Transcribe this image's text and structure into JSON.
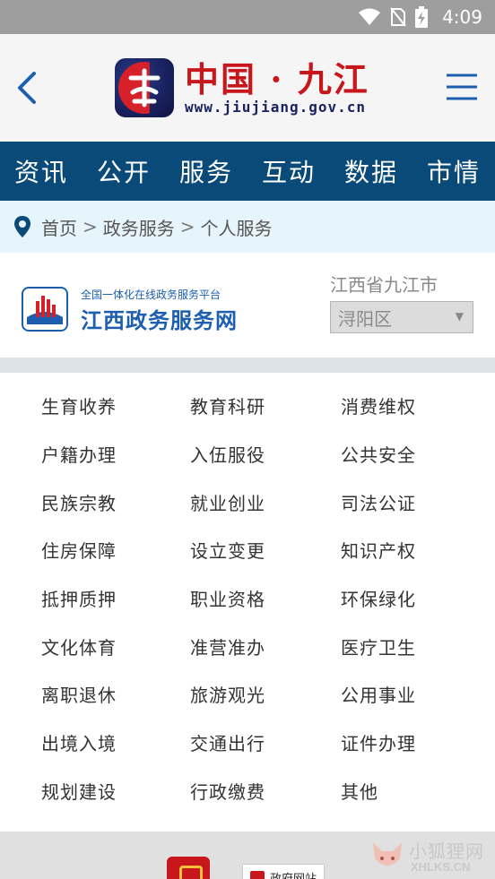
{
  "status_bar": {
    "time": "4:09",
    "icons": [
      "wifi-icon",
      "no-sim-icon",
      "battery-charging-icon"
    ]
  },
  "header": {
    "back_icon": "chevron-left-icon",
    "menu_icon": "hamburger-menu-icon",
    "logo_title": "中国 · 九江",
    "logo_url": "www.jiujiang.gov.cn"
  },
  "nav": {
    "items": [
      "资讯",
      "公开",
      "服务",
      "互动",
      "数据",
      "市情"
    ]
  },
  "breadcrumb": {
    "icon": "location-pin-icon",
    "items": [
      "首页",
      "政务服务",
      "个人服务"
    ],
    "separator": ">"
  },
  "platform": {
    "subtitle": "全国一体化在线政务服务平台",
    "title": "江西政务服务网",
    "region_label": "江西省九江市",
    "region_selected": "浔阳区",
    "arrow": "▼"
  },
  "services": {
    "items": [
      "生育收养",
      "教育科研",
      "消费维权",
      "户籍办理",
      "入伍服役",
      "公共安全",
      "民族宗教",
      "就业创业",
      "司法公证",
      "住房保障",
      "设立变更",
      "知识产权",
      "抵押质押",
      "职业资格",
      "环保绿化",
      "文化体育",
      "准营准办",
      "医疗卫生",
      "离职退休",
      "旅游观光",
      "公用事业",
      "出境入境",
      "交通出行",
      "证件办理",
      "规划建设",
      "行政缴费",
      "其他"
    ]
  },
  "footer": {
    "gov_badge": "政府网站",
    "watermark_cn": "小狐狸网",
    "watermark_en": "XHLKS.CN"
  },
  "colors": {
    "nav_bg": "#0a4a78",
    "breadcrumb_bg": "#e6f4fb",
    "logo_red": "#c8161d",
    "platform_blue": "#1d5fae"
  }
}
